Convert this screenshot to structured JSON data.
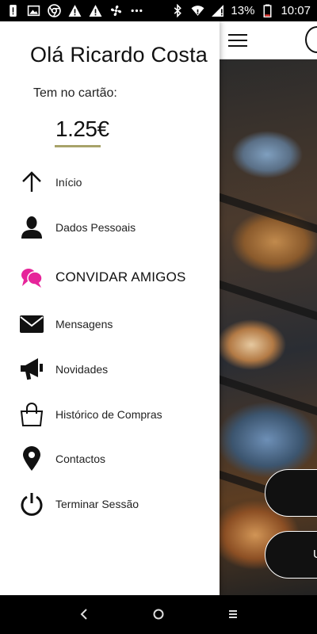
{
  "status_bar": {
    "icons": [
      "sim-alert-icon",
      "image-icon",
      "chrome-icon",
      "warning-icon",
      "warning-icon",
      "fan-icon",
      "more-icon",
      "bluetooth-icon",
      "wifi-icon",
      "signal-icon"
    ],
    "battery_text": "13%",
    "time": "10:07"
  },
  "drawer": {
    "greeting": "Olá Ricardo Costa",
    "card_label": "Tem no cartão:",
    "balance": "1.25€",
    "accent_color": "#a8a36a",
    "items": [
      {
        "label": "Início",
        "icon": "arrow-up-icon"
      },
      {
        "label": "Dados Pessoais",
        "icon": "person-icon"
      },
      {
        "label": "CONVIDAR AMIGOS",
        "icon": "chat-bubbles-icon",
        "color": "#e6249a"
      },
      {
        "label": "Mensagens",
        "icon": "envelope-icon"
      },
      {
        "label": "Novidades",
        "icon": "megaphone-icon"
      },
      {
        "label": "Histórico de Compras",
        "icon": "shopping-bag-icon"
      },
      {
        "label": "Contactos",
        "icon": "location-pin-icon"
      },
      {
        "label": "Terminar Sessão",
        "icon": "power-icon"
      }
    ]
  },
  "background_app": {
    "menu_icon": "hamburger-icon",
    "button_partial_text": "U"
  },
  "nav_bar": {
    "buttons": [
      "back-icon",
      "home-icon",
      "recents-icon"
    ]
  }
}
